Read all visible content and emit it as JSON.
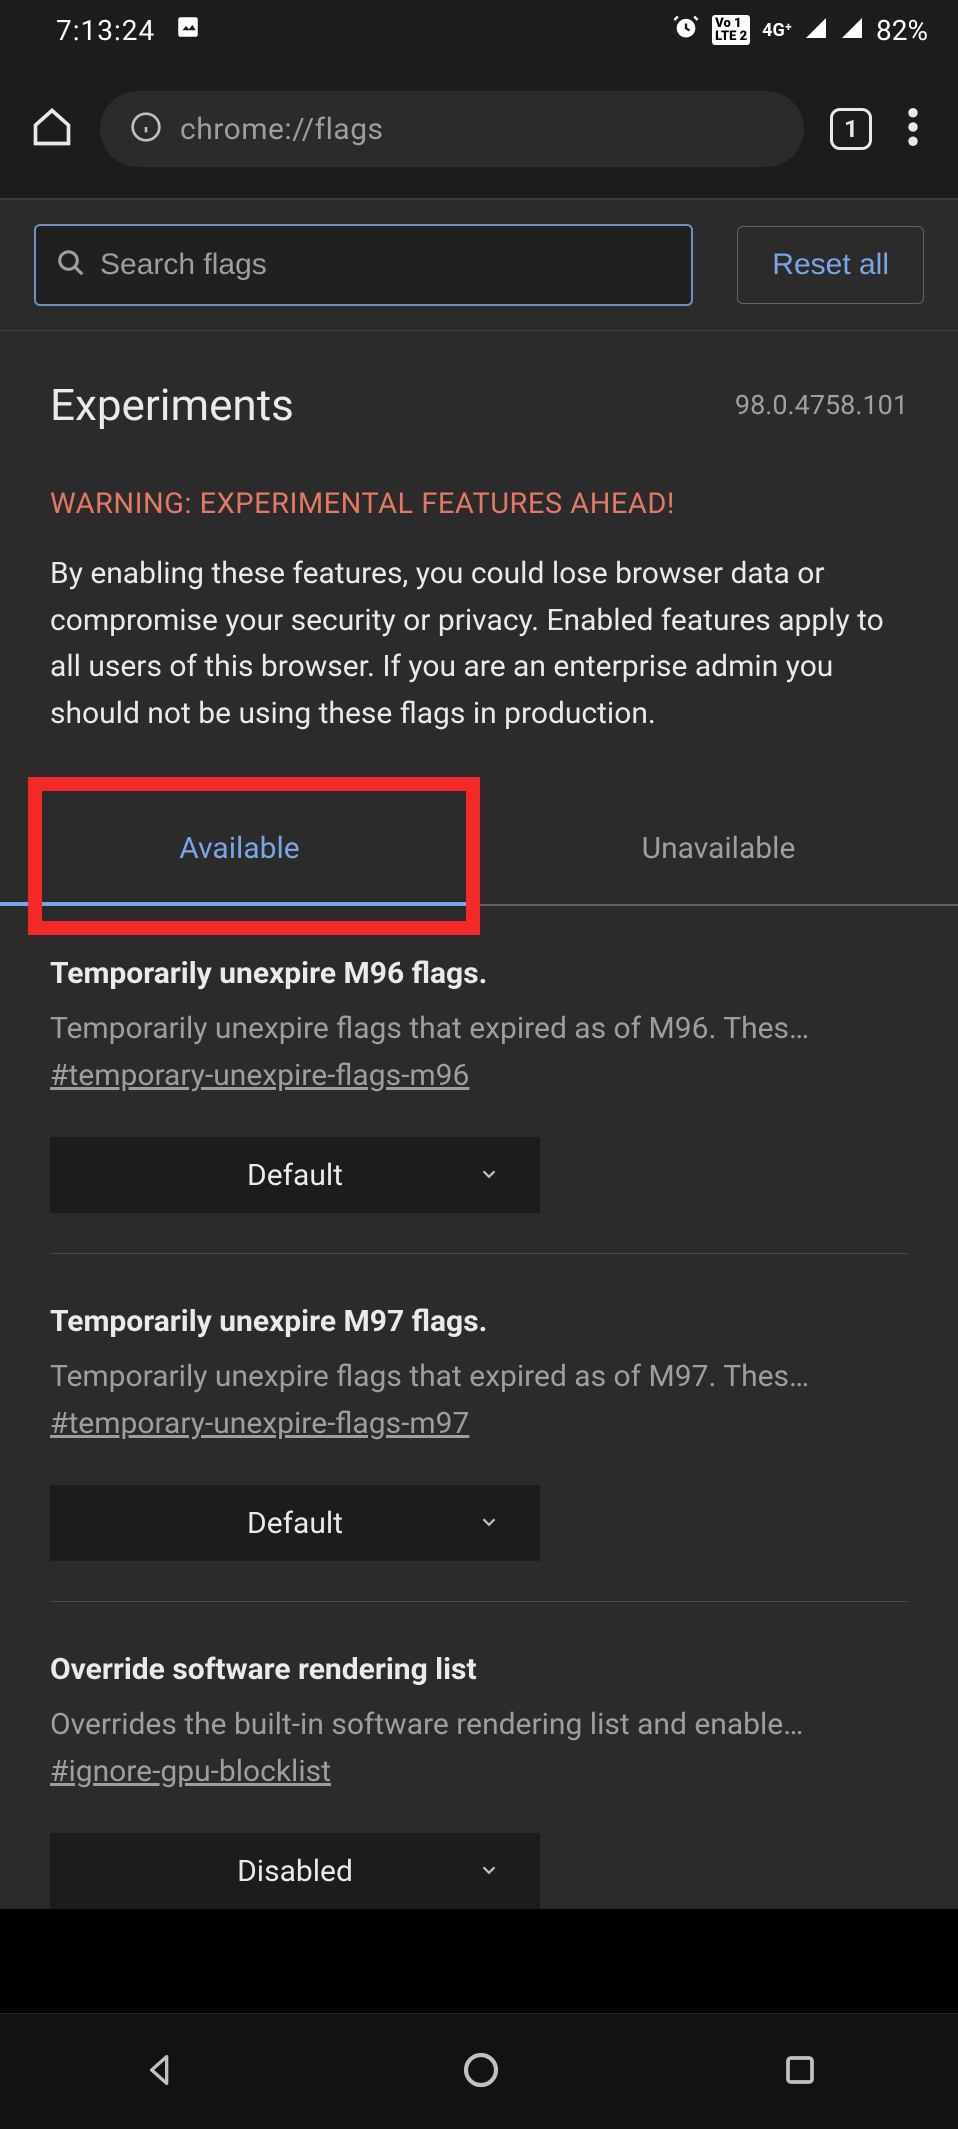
{
  "status": {
    "time": "7:13:24",
    "battery": "82%"
  },
  "browser": {
    "url": "chrome://flags",
    "tabs": "1"
  },
  "search": {
    "placeholder": "Search flags",
    "reset": "Reset all"
  },
  "header": {
    "title": "Experiments",
    "version": "98.0.4758.101"
  },
  "warning": {
    "heading": "WARNING: EXPERIMENTAL FEATURES AHEAD!",
    "body": "By enabling these features, you could lose browser data or compromise your security or privacy. Enabled features apply to all users of this browser. If you are an enterprise admin you should not be using these flags in production."
  },
  "tabs": {
    "available": "Available",
    "unavailable": "Unavailable"
  },
  "flags": [
    {
      "title": "Temporarily unexpire M96 flags.",
      "desc": "Temporarily unexpire flags that expired as of M96. Thes…",
      "anchor": "#temporary-unexpire-flags-m96",
      "value": "Default"
    },
    {
      "title": "Temporarily unexpire M97 flags.",
      "desc": "Temporarily unexpire flags that expired as of M97. Thes…",
      "anchor": "#temporary-unexpire-flags-m97",
      "value": "Default"
    },
    {
      "title": "Override software rendering list",
      "desc": "Overrides the built-in software rendering list and enable…",
      "anchor": "#ignore-gpu-blocklist",
      "value": "Disabled"
    }
  ]
}
